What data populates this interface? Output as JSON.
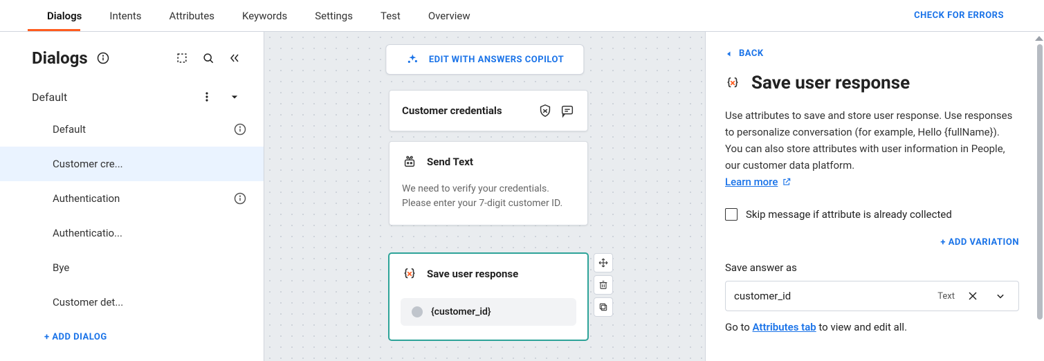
{
  "tabs": [
    "Dialogs",
    "Intents",
    "Attributes",
    "Keywords",
    "Settings",
    "Test",
    "Overview"
  ],
  "active_tab": "Dialogs",
  "check_errors": "CHECK FOR ERRORS",
  "sidebar": {
    "title": "Dialogs",
    "group": "Default",
    "items": [
      {
        "label": "Default",
        "info": true
      },
      {
        "label": "Customer cre...",
        "active": true
      },
      {
        "label": "Authentication",
        "info": true
      },
      {
        "label": "Authenticatio..."
      },
      {
        "label": "Bye"
      },
      {
        "label": "Customer det..."
      }
    ],
    "add": "+ ADD DIALOG"
  },
  "canvas": {
    "copilot": "EDIT WITH ANSWERS COPILOT",
    "card_title": "Customer credentials",
    "send_text_title": "Send Text",
    "send_text_body": "We need to verify your credentials. Please enter your 7-digit customer ID.",
    "save_title": "Save user response",
    "save_chip": "{customer_id}"
  },
  "panel": {
    "back": "BACK",
    "title": "Save user response",
    "desc": "Use attributes to save and store user response. Use responses to personalize conversation (for example, Hello {fullName}). You can also store attributes with user information in People, our customer data platform.",
    "learn_more": "Learn more",
    "skip": "Skip message if attribute is already collected",
    "add_variation": "+ ADD VARIATION",
    "field_label": "Save answer as",
    "field_value": "customer_id",
    "field_type": "Text",
    "note_pre": "Go to ",
    "note_link": "Attributes tab",
    "note_post": " to view and edit all."
  }
}
